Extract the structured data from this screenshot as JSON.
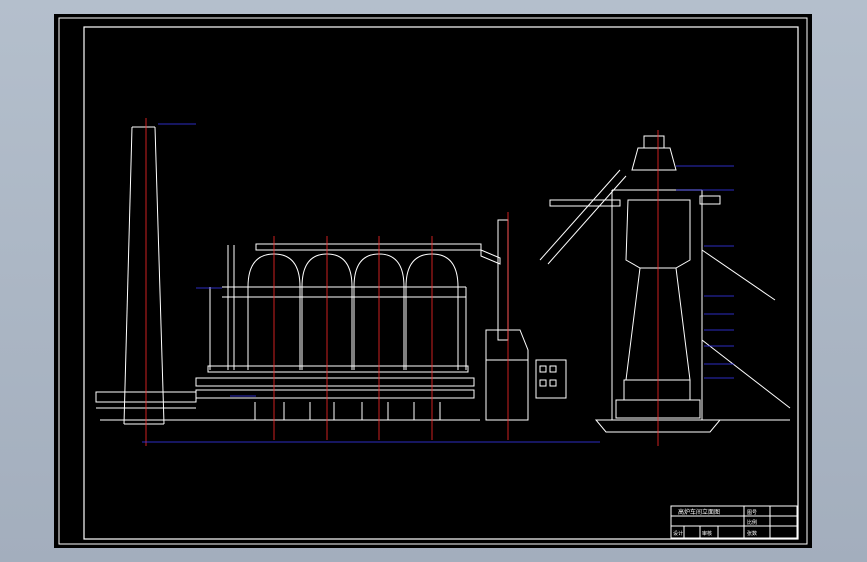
{
  "drawing": {
    "title_block": {
      "title": "高炉车间立面图",
      "row_labels": [
        "设计",
        "审核"
      ],
      "code_cells": [
        "图号",
        "比例",
        "张数"
      ]
    }
  },
  "colors": {
    "background": "#000000",
    "outline": "#ffffff",
    "centerline": "#ff2a2a",
    "annotation": "#3a3aff",
    "viewport": "#aab5c3"
  }
}
